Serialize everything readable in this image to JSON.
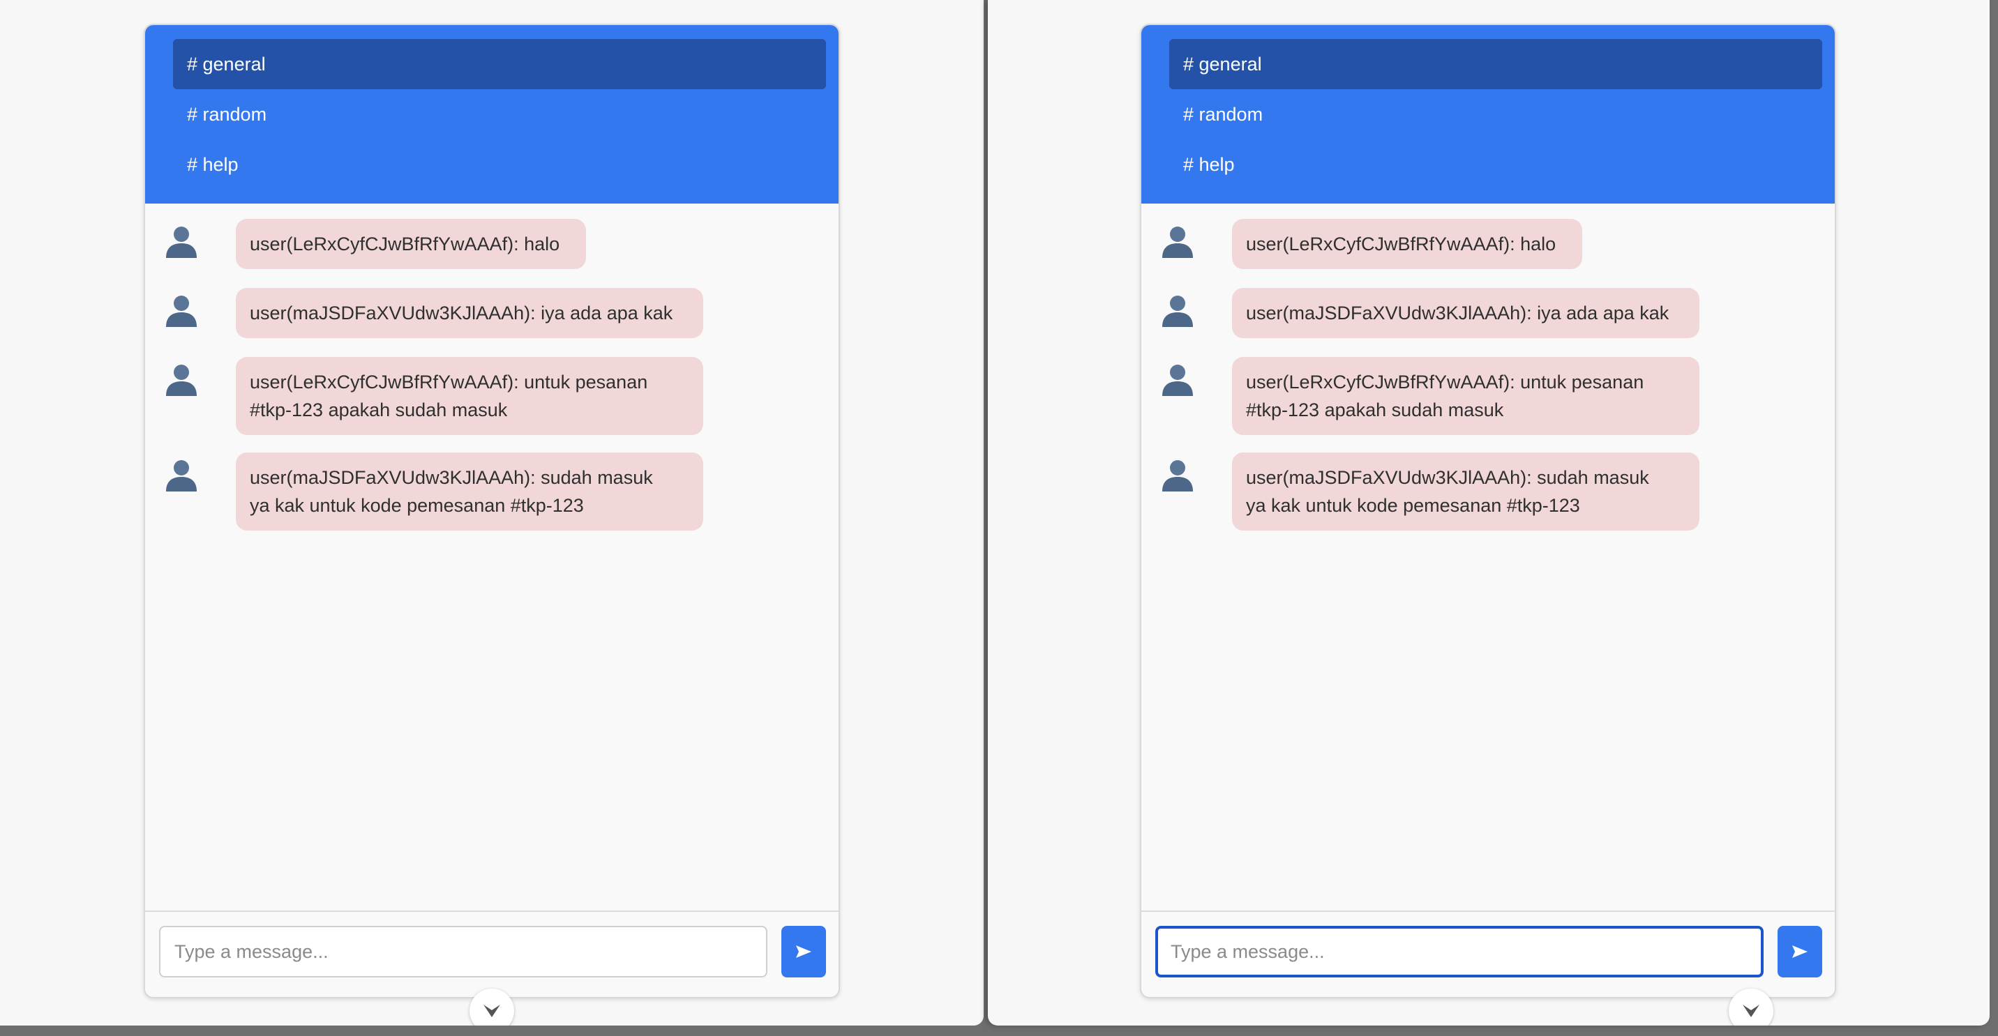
{
  "panels": [
    {
      "channels": [
        {
          "label": "# general",
          "active": true
        },
        {
          "label": "# random",
          "active": false
        },
        {
          "label": "# help",
          "active": false
        }
      ],
      "messages": [
        {
          "text": "user(LeRxCyfCJwBfRfYwAAAf): halo"
        },
        {
          "text": "user(maJSDFaXVUdw3KJlAAAh): iya ada apa kak"
        },
        {
          "text": "user(LeRxCyfCJwBfRfYwAAAf): untuk pesanan\n#tkp-123 apakah sudah masuk"
        },
        {
          "text": "user(maJSDFaXVUdw3KJlAAAh): sudah masuk\nya kak untuk kode pemesanan #tkp-123"
        }
      ],
      "input": {
        "placeholder": "Type a message...",
        "value": "",
        "focused": false
      },
      "send_icon": "send-arrow-icon"
    },
    {
      "channels": [
        {
          "label": "# general",
          "active": true
        },
        {
          "label": "# random",
          "active": false
        },
        {
          "label": "# help",
          "active": false
        }
      ],
      "messages": [
        {
          "text": "user(LeRxCyfCJwBfRfYwAAAf): halo"
        },
        {
          "text": "user(maJSDFaXVUdw3KJlAAAh): iya ada apa kak"
        },
        {
          "text": "user(LeRxCyfCJwBfRfYwAAAf): untuk pesanan\n#tkp-123 apakah sudah masuk"
        },
        {
          "text": "user(maJSDFaXVUdw3KJlAAAh): sudah masuk\nya kak untuk kode pemesanan #tkp-123"
        }
      ],
      "input": {
        "placeholder": "Type a message...",
        "value": "",
        "focused": true
      },
      "send_icon": "send-arrow-icon"
    }
  ],
  "colors": {
    "header": "#3478f0",
    "active_channel": "#2352a8",
    "bubble": "#f1d7d8",
    "send_button": "#3478f0"
  }
}
